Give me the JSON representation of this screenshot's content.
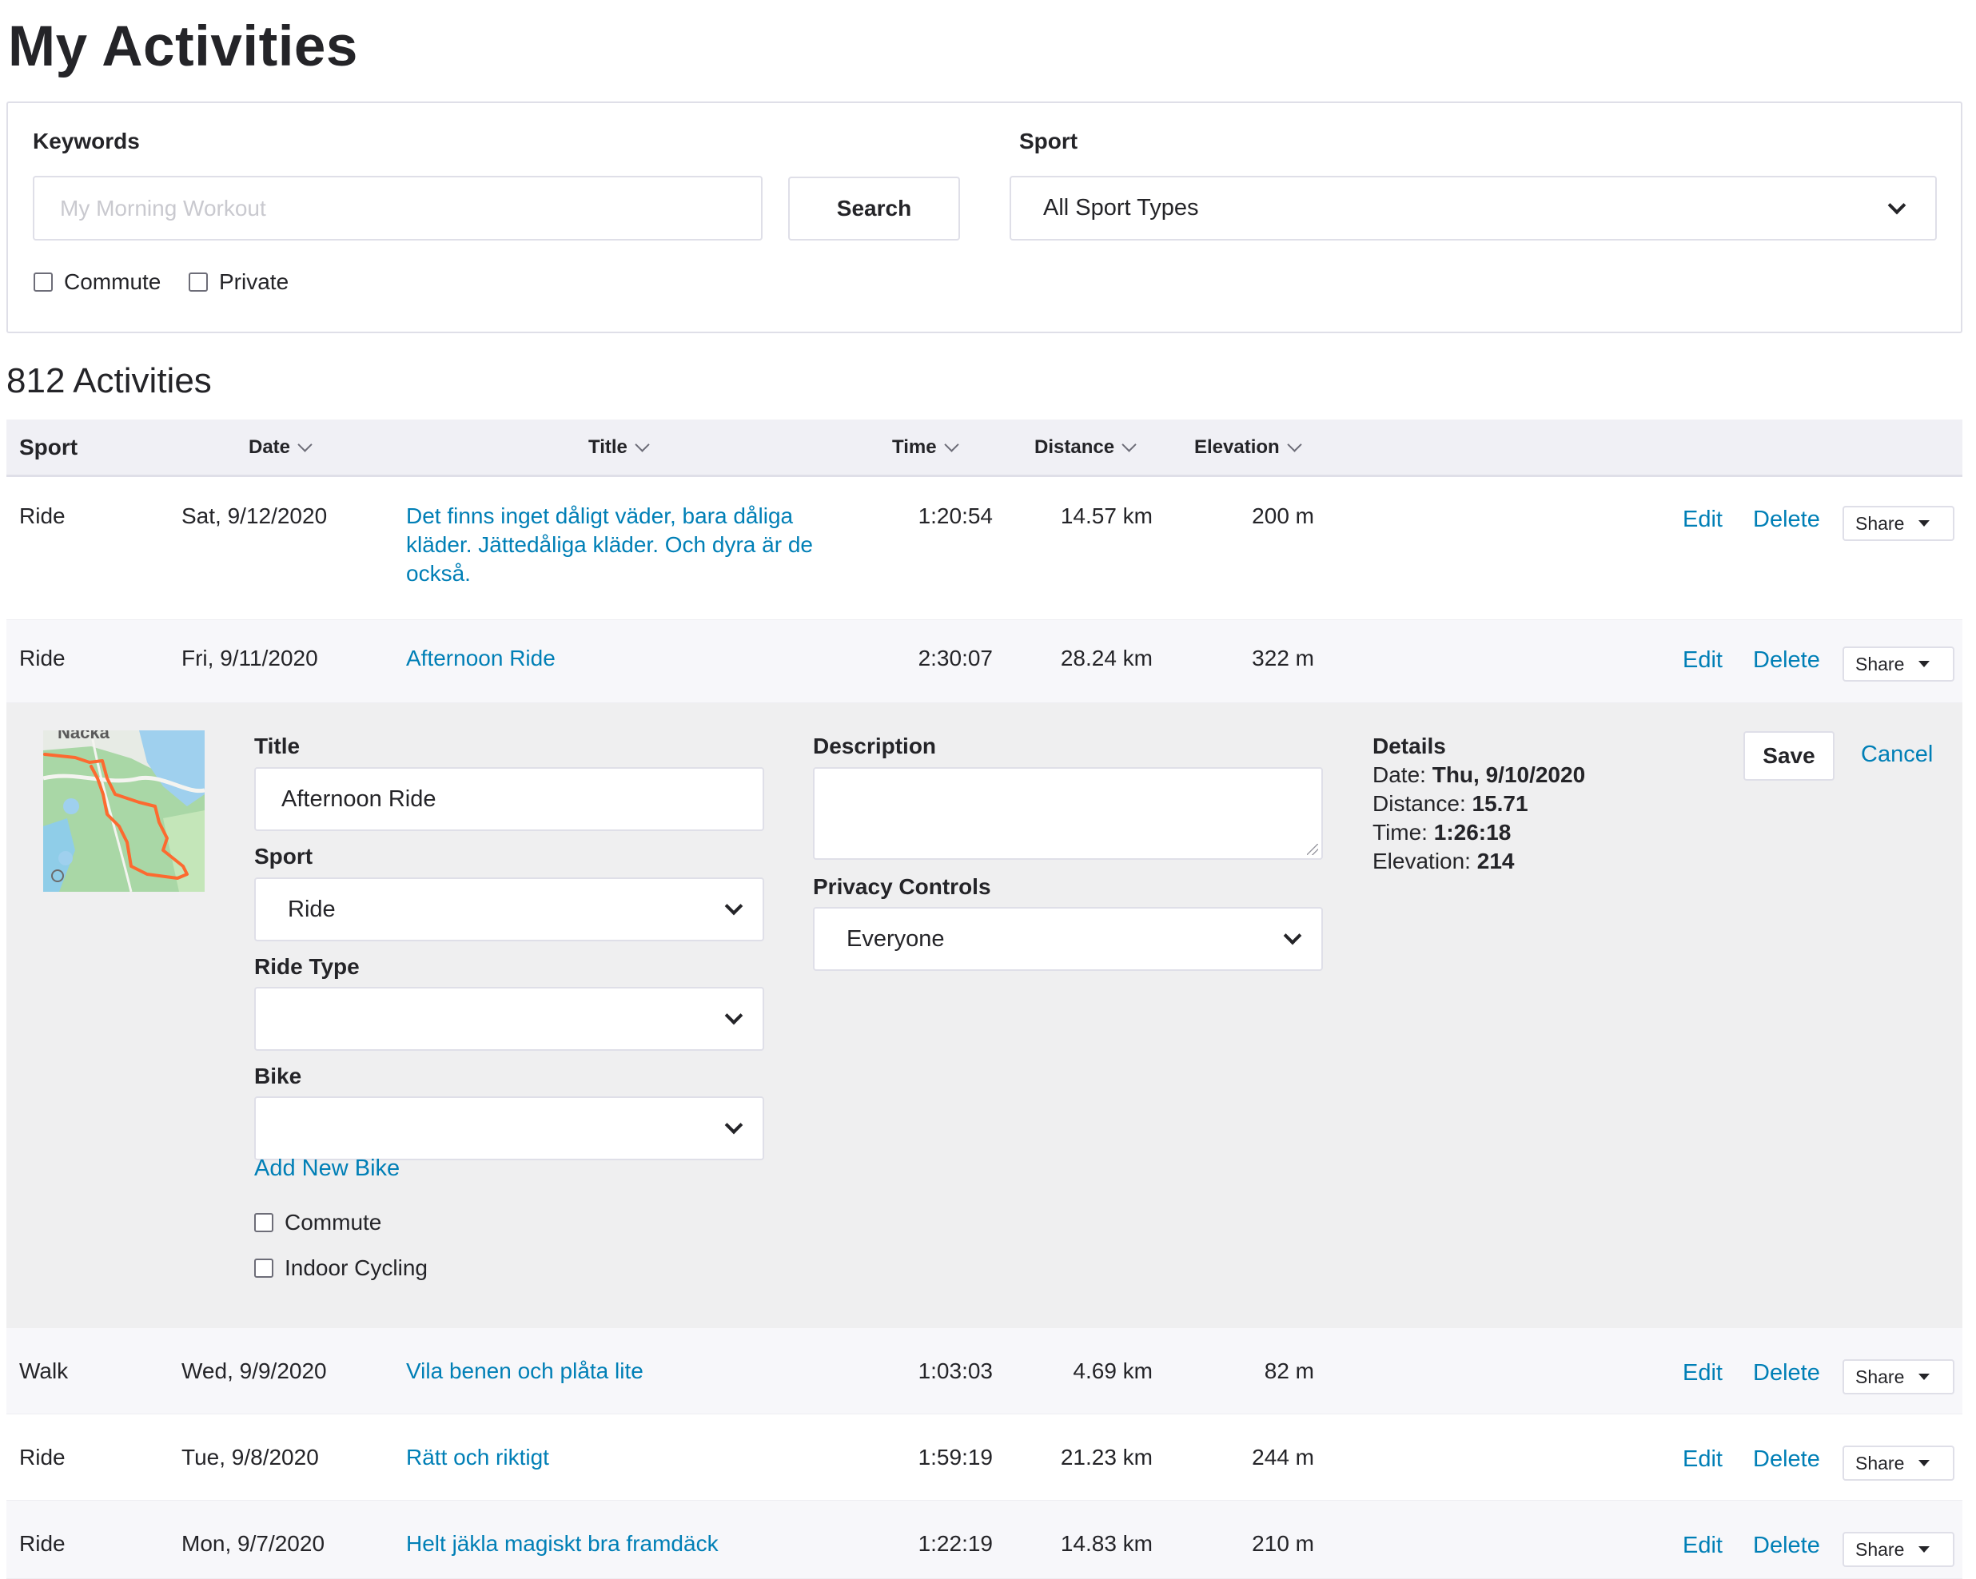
{
  "page": {
    "title": "My Activities"
  },
  "filters": {
    "keywords_label": "Keywords",
    "keywords_placeholder": "My Morning Workout",
    "search_label": "Search",
    "sport_label": "Sport",
    "sport_value": "All Sport Types",
    "commute_label": "Commute",
    "private_label": "Private"
  },
  "summary": {
    "count_text": "812 Activities"
  },
  "table": {
    "headers": {
      "sport": "Sport",
      "date": "Date",
      "title": "Title",
      "time": "Time",
      "distance": "Distance",
      "elevation": "Elevation"
    },
    "actions": {
      "edit": "Edit",
      "delete": "Delete",
      "share": "Share"
    },
    "rows": [
      {
        "sport": "Ride",
        "date": "Sat, 9/12/2020",
        "title_lines": [
          "Det finns inget dåligt väder, bara dåliga",
          "kläder. Jättedåliga kläder. Och dyra är de",
          "också."
        ],
        "time": "1:20:54",
        "distance": "14.57 km",
        "elevation": "200 m"
      },
      {
        "sport": "Ride",
        "date": "Fri, 9/11/2020",
        "title_lines": [
          "Afternoon Ride"
        ],
        "time": "2:30:07",
        "distance": "28.24 km",
        "elevation": "322 m"
      },
      {
        "sport": "Walk",
        "date": "Wed, 9/9/2020",
        "title_lines": [
          "Vila benen och plåta lite"
        ],
        "time": "1:03:03",
        "distance": "4.69 km",
        "elevation": "82 m"
      },
      {
        "sport": "Ride",
        "date": "Tue, 9/8/2020",
        "title_lines": [
          "Rätt och riktigt"
        ],
        "time": "1:59:19",
        "distance": "21.23 km",
        "elevation": "244 m"
      },
      {
        "sport": "Ride",
        "date": "Mon, 9/7/2020",
        "title_lines": [
          "Helt jäkla magiskt bra framdäck"
        ],
        "time": "1:22:19",
        "distance": "14.83 km",
        "elevation": "210 m"
      }
    ]
  },
  "edit": {
    "map_label": "Nacka",
    "title_label": "Title",
    "title_value": "Afternoon Ride",
    "sport_label": "Sport",
    "sport_value": "Ride",
    "ride_type_label": "Ride Type",
    "ride_type_value": "",
    "bike_label": "Bike",
    "bike_value": "",
    "add_bike_label": "Add New Bike",
    "commute_label": "Commute",
    "indoor_label": "Indoor Cycling",
    "description_label": "Description",
    "description_value": "",
    "privacy_label": "Privacy Controls",
    "privacy_value": "Everyone",
    "details_heading": "Details",
    "details": {
      "date_label": "Date:",
      "date_value": "Thu, 9/10/2020",
      "distance_label": "Distance:",
      "distance_value": "15.71",
      "time_label": "Time:",
      "time_value": "1:26:18",
      "elevation_label": "Elevation:",
      "elevation_value": "214"
    },
    "save_label": "Save",
    "cancel_label": "Cancel"
  },
  "colors": {
    "link": "#007fb6",
    "text": "#242428",
    "route": "#fc6a30",
    "panel_bg": "#efeff0"
  }
}
